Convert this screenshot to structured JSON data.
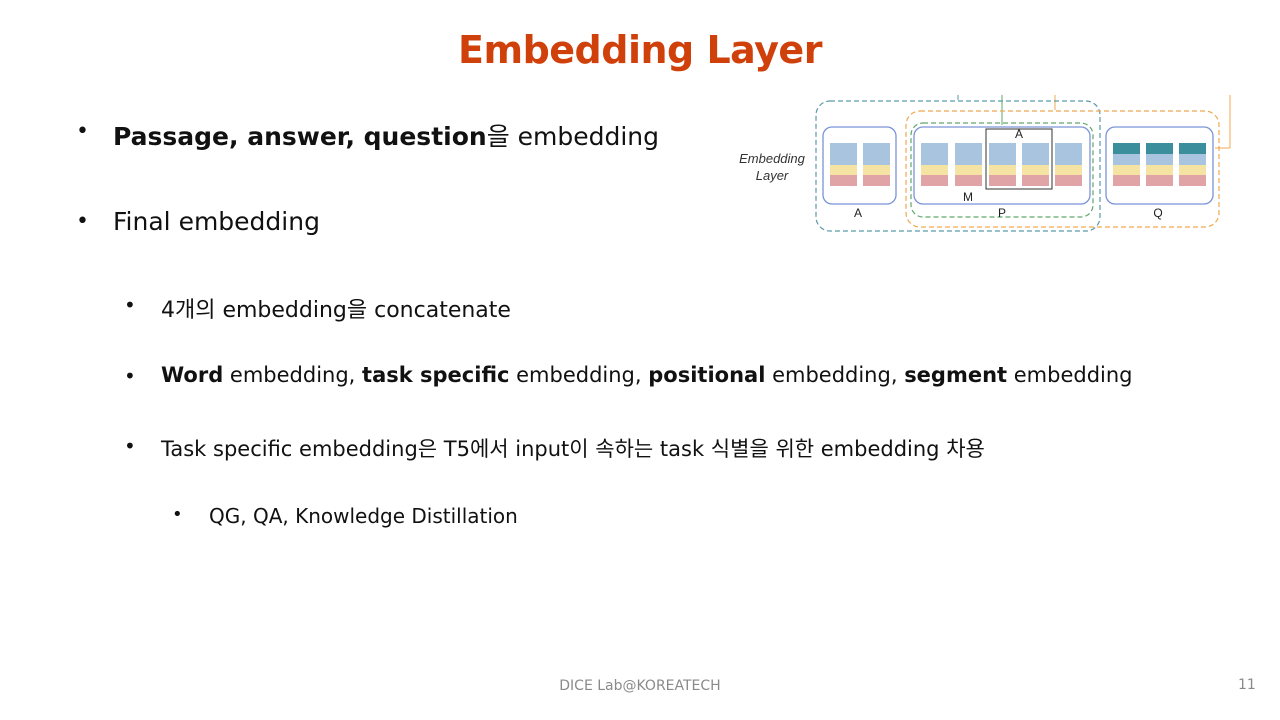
{
  "title": "Embedding Layer",
  "bullets": {
    "b1": {
      "bold": "Passage, answer, question",
      "rest": "을 embedding"
    },
    "b2": {
      "text": "Final embedding"
    },
    "b3": {
      "text": "4개의 embedding을 concatenate"
    },
    "b4": {
      "w_bold": "Word",
      "w_rest": " embedding, ",
      "t_bold": "task specific",
      "t_rest": " embedding, ",
      "p_bold": "positional",
      "p_rest": " embedding, ",
      "s_bold": "segment",
      "s_rest": " embedding"
    },
    "b5": {
      "text": "Task specific embedding은 T5에서 input이 속하는 task 식별을 위한 embedding 차용"
    },
    "b6": {
      "text": "QG, QA, Knowledge Distillation"
    }
  },
  "diagram": {
    "layer_label_line1": "Embedding",
    "layer_label_line2": "Layer",
    "group_a_label": "A",
    "group_p_label": "P",
    "group_q_label": "Q",
    "m_label": "M",
    "a_box_label": "A",
    "colors": {
      "blue": "#a9c4de",
      "yellow": "#f5e3a3",
      "red": "#e0a3a6",
      "teal": "#3b8f9d",
      "group_border": "#7a94d6",
      "green_dash": "#5fa86a",
      "orange_dash": "#f0a850",
      "teal_dash": "#5a9aa6"
    }
  },
  "footer": "DICE Lab@KOREATECH",
  "page_number": "11"
}
